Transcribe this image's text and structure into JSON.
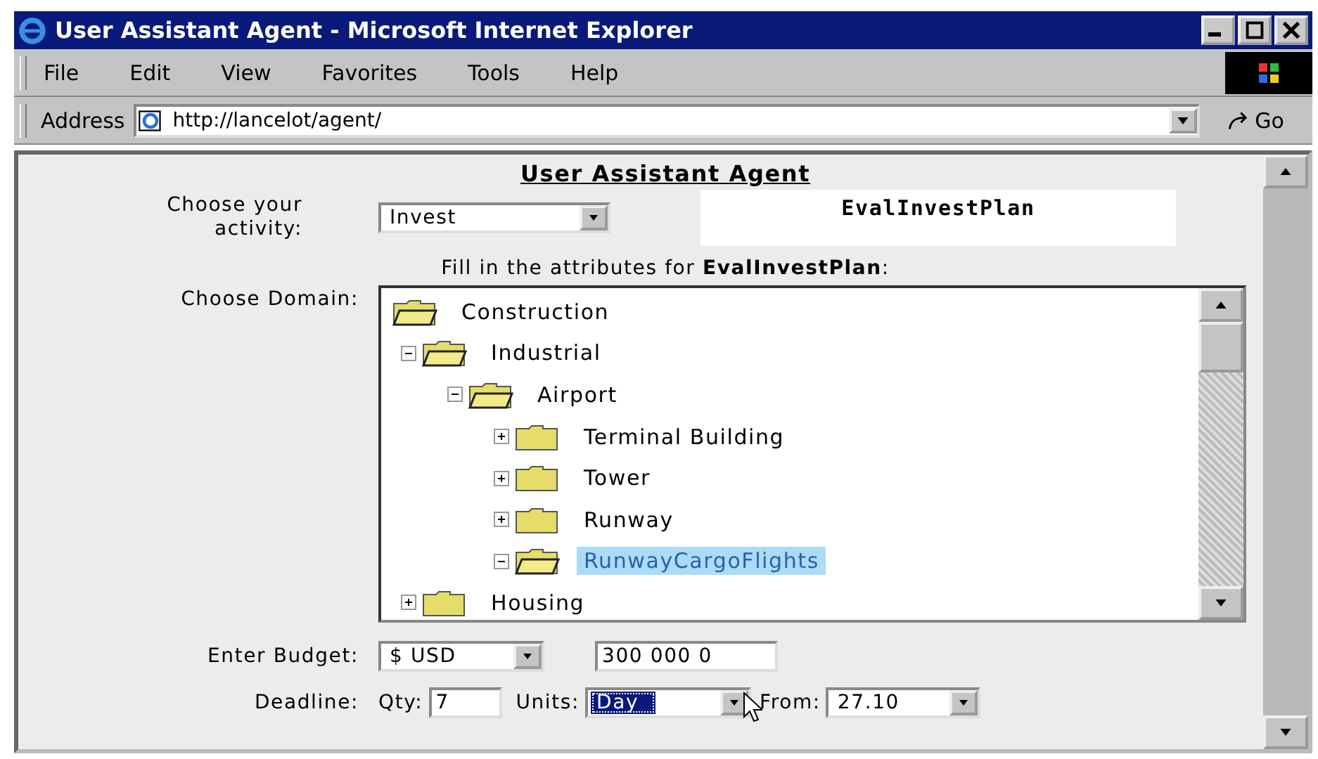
{
  "window": {
    "title": "User Assistant Agent - Microsoft Internet Explorer"
  },
  "menu": [
    "File",
    "Edit",
    "View",
    "Favorites",
    "Tools",
    "Help"
  ],
  "address": {
    "label": "Address",
    "value": "http://lancelot/agent/",
    "go": "Go"
  },
  "page": {
    "heading": "User Assistant Agent",
    "activity": {
      "label": "Choose your activity:",
      "value": "Invest",
      "plan": "EvalInvestPlan"
    },
    "instruction": "Fill in the attributes for **EvalInvestPlan**:",
    "domain_label": "Choose Domain:",
    "tree": [
      {
        "label": "Construction",
        "expanded": true,
        "selected": false,
        "children": [
          {
            "label": "Industrial",
            "expanded": true,
            "selected": false,
            "children": [
              {
                "label": "Airport",
                "expanded": true,
                "selected": false,
                "children": [
                  {
                    "label": "Terminal Building",
                    "expanded": false,
                    "selected": false
                  },
                  {
                    "label": "Tower",
                    "expanded": false,
                    "selected": false
                  },
                  {
                    "label": "Runway",
                    "expanded": false,
                    "selected": false
                  },
                  {
                    "label": "RunwayCargoFlights",
                    "expanded": true,
                    "selected": true
                  }
                ]
              }
            ]
          },
          {
            "label": "Housing",
            "expanded": false,
            "selected": false
          }
        ]
      }
    ],
    "budget": {
      "label": "Enter Budget:",
      "currency": "$ USD",
      "amount": "300 000 0"
    },
    "deadline": {
      "label": "Deadline:",
      "qty_label": "Qty:",
      "qty": "7",
      "units_label": "Units:",
      "units": "Day",
      "from_label": "From:",
      "from": "27.10"
    }
  }
}
